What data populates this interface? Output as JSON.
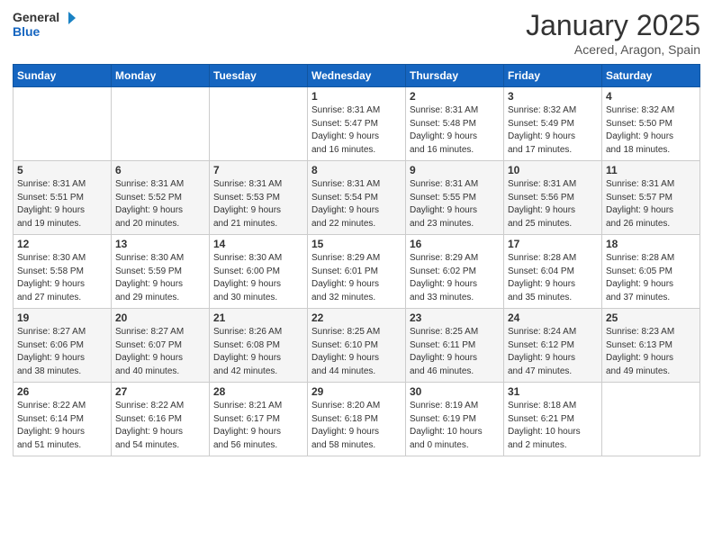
{
  "logo": {
    "general": "General",
    "blue": "Blue"
  },
  "title": "January 2025",
  "location": "Acered, Aragon, Spain",
  "days_header": [
    "Sunday",
    "Monday",
    "Tuesday",
    "Wednesday",
    "Thursday",
    "Friday",
    "Saturday"
  ],
  "weeks": [
    [
      {
        "day": "",
        "info": ""
      },
      {
        "day": "",
        "info": ""
      },
      {
        "day": "",
        "info": ""
      },
      {
        "day": "1",
        "info": "Sunrise: 8:31 AM\nSunset: 5:47 PM\nDaylight: 9 hours\nand 16 minutes."
      },
      {
        "day": "2",
        "info": "Sunrise: 8:31 AM\nSunset: 5:48 PM\nDaylight: 9 hours\nand 16 minutes."
      },
      {
        "day": "3",
        "info": "Sunrise: 8:32 AM\nSunset: 5:49 PM\nDaylight: 9 hours\nand 17 minutes."
      },
      {
        "day": "4",
        "info": "Sunrise: 8:32 AM\nSunset: 5:50 PM\nDaylight: 9 hours\nand 18 minutes."
      }
    ],
    [
      {
        "day": "5",
        "info": "Sunrise: 8:31 AM\nSunset: 5:51 PM\nDaylight: 9 hours\nand 19 minutes."
      },
      {
        "day": "6",
        "info": "Sunrise: 8:31 AM\nSunset: 5:52 PM\nDaylight: 9 hours\nand 20 minutes."
      },
      {
        "day": "7",
        "info": "Sunrise: 8:31 AM\nSunset: 5:53 PM\nDaylight: 9 hours\nand 21 minutes."
      },
      {
        "day": "8",
        "info": "Sunrise: 8:31 AM\nSunset: 5:54 PM\nDaylight: 9 hours\nand 22 minutes."
      },
      {
        "day": "9",
        "info": "Sunrise: 8:31 AM\nSunset: 5:55 PM\nDaylight: 9 hours\nand 23 minutes."
      },
      {
        "day": "10",
        "info": "Sunrise: 8:31 AM\nSunset: 5:56 PM\nDaylight: 9 hours\nand 25 minutes."
      },
      {
        "day": "11",
        "info": "Sunrise: 8:31 AM\nSunset: 5:57 PM\nDaylight: 9 hours\nand 26 minutes."
      }
    ],
    [
      {
        "day": "12",
        "info": "Sunrise: 8:30 AM\nSunset: 5:58 PM\nDaylight: 9 hours\nand 27 minutes."
      },
      {
        "day": "13",
        "info": "Sunrise: 8:30 AM\nSunset: 5:59 PM\nDaylight: 9 hours\nand 29 minutes."
      },
      {
        "day": "14",
        "info": "Sunrise: 8:30 AM\nSunset: 6:00 PM\nDaylight: 9 hours\nand 30 minutes."
      },
      {
        "day": "15",
        "info": "Sunrise: 8:29 AM\nSunset: 6:01 PM\nDaylight: 9 hours\nand 32 minutes."
      },
      {
        "day": "16",
        "info": "Sunrise: 8:29 AM\nSunset: 6:02 PM\nDaylight: 9 hours\nand 33 minutes."
      },
      {
        "day": "17",
        "info": "Sunrise: 8:28 AM\nSunset: 6:04 PM\nDaylight: 9 hours\nand 35 minutes."
      },
      {
        "day": "18",
        "info": "Sunrise: 8:28 AM\nSunset: 6:05 PM\nDaylight: 9 hours\nand 37 minutes."
      }
    ],
    [
      {
        "day": "19",
        "info": "Sunrise: 8:27 AM\nSunset: 6:06 PM\nDaylight: 9 hours\nand 38 minutes."
      },
      {
        "day": "20",
        "info": "Sunrise: 8:27 AM\nSunset: 6:07 PM\nDaylight: 9 hours\nand 40 minutes."
      },
      {
        "day": "21",
        "info": "Sunrise: 8:26 AM\nSunset: 6:08 PM\nDaylight: 9 hours\nand 42 minutes."
      },
      {
        "day": "22",
        "info": "Sunrise: 8:25 AM\nSunset: 6:10 PM\nDaylight: 9 hours\nand 44 minutes."
      },
      {
        "day": "23",
        "info": "Sunrise: 8:25 AM\nSunset: 6:11 PM\nDaylight: 9 hours\nand 46 minutes."
      },
      {
        "day": "24",
        "info": "Sunrise: 8:24 AM\nSunset: 6:12 PM\nDaylight: 9 hours\nand 47 minutes."
      },
      {
        "day": "25",
        "info": "Sunrise: 8:23 AM\nSunset: 6:13 PM\nDaylight: 9 hours\nand 49 minutes."
      }
    ],
    [
      {
        "day": "26",
        "info": "Sunrise: 8:22 AM\nSunset: 6:14 PM\nDaylight: 9 hours\nand 51 minutes."
      },
      {
        "day": "27",
        "info": "Sunrise: 8:22 AM\nSunset: 6:16 PM\nDaylight: 9 hours\nand 54 minutes."
      },
      {
        "day": "28",
        "info": "Sunrise: 8:21 AM\nSunset: 6:17 PM\nDaylight: 9 hours\nand 56 minutes."
      },
      {
        "day": "29",
        "info": "Sunrise: 8:20 AM\nSunset: 6:18 PM\nDaylight: 9 hours\nand 58 minutes."
      },
      {
        "day": "30",
        "info": "Sunrise: 8:19 AM\nSunset: 6:19 PM\nDaylight: 10 hours\nand 0 minutes."
      },
      {
        "day": "31",
        "info": "Sunrise: 8:18 AM\nSunset: 6:21 PM\nDaylight: 10 hours\nand 2 minutes."
      },
      {
        "day": "",
        "info": ""
      }
    ]
  ]
}
